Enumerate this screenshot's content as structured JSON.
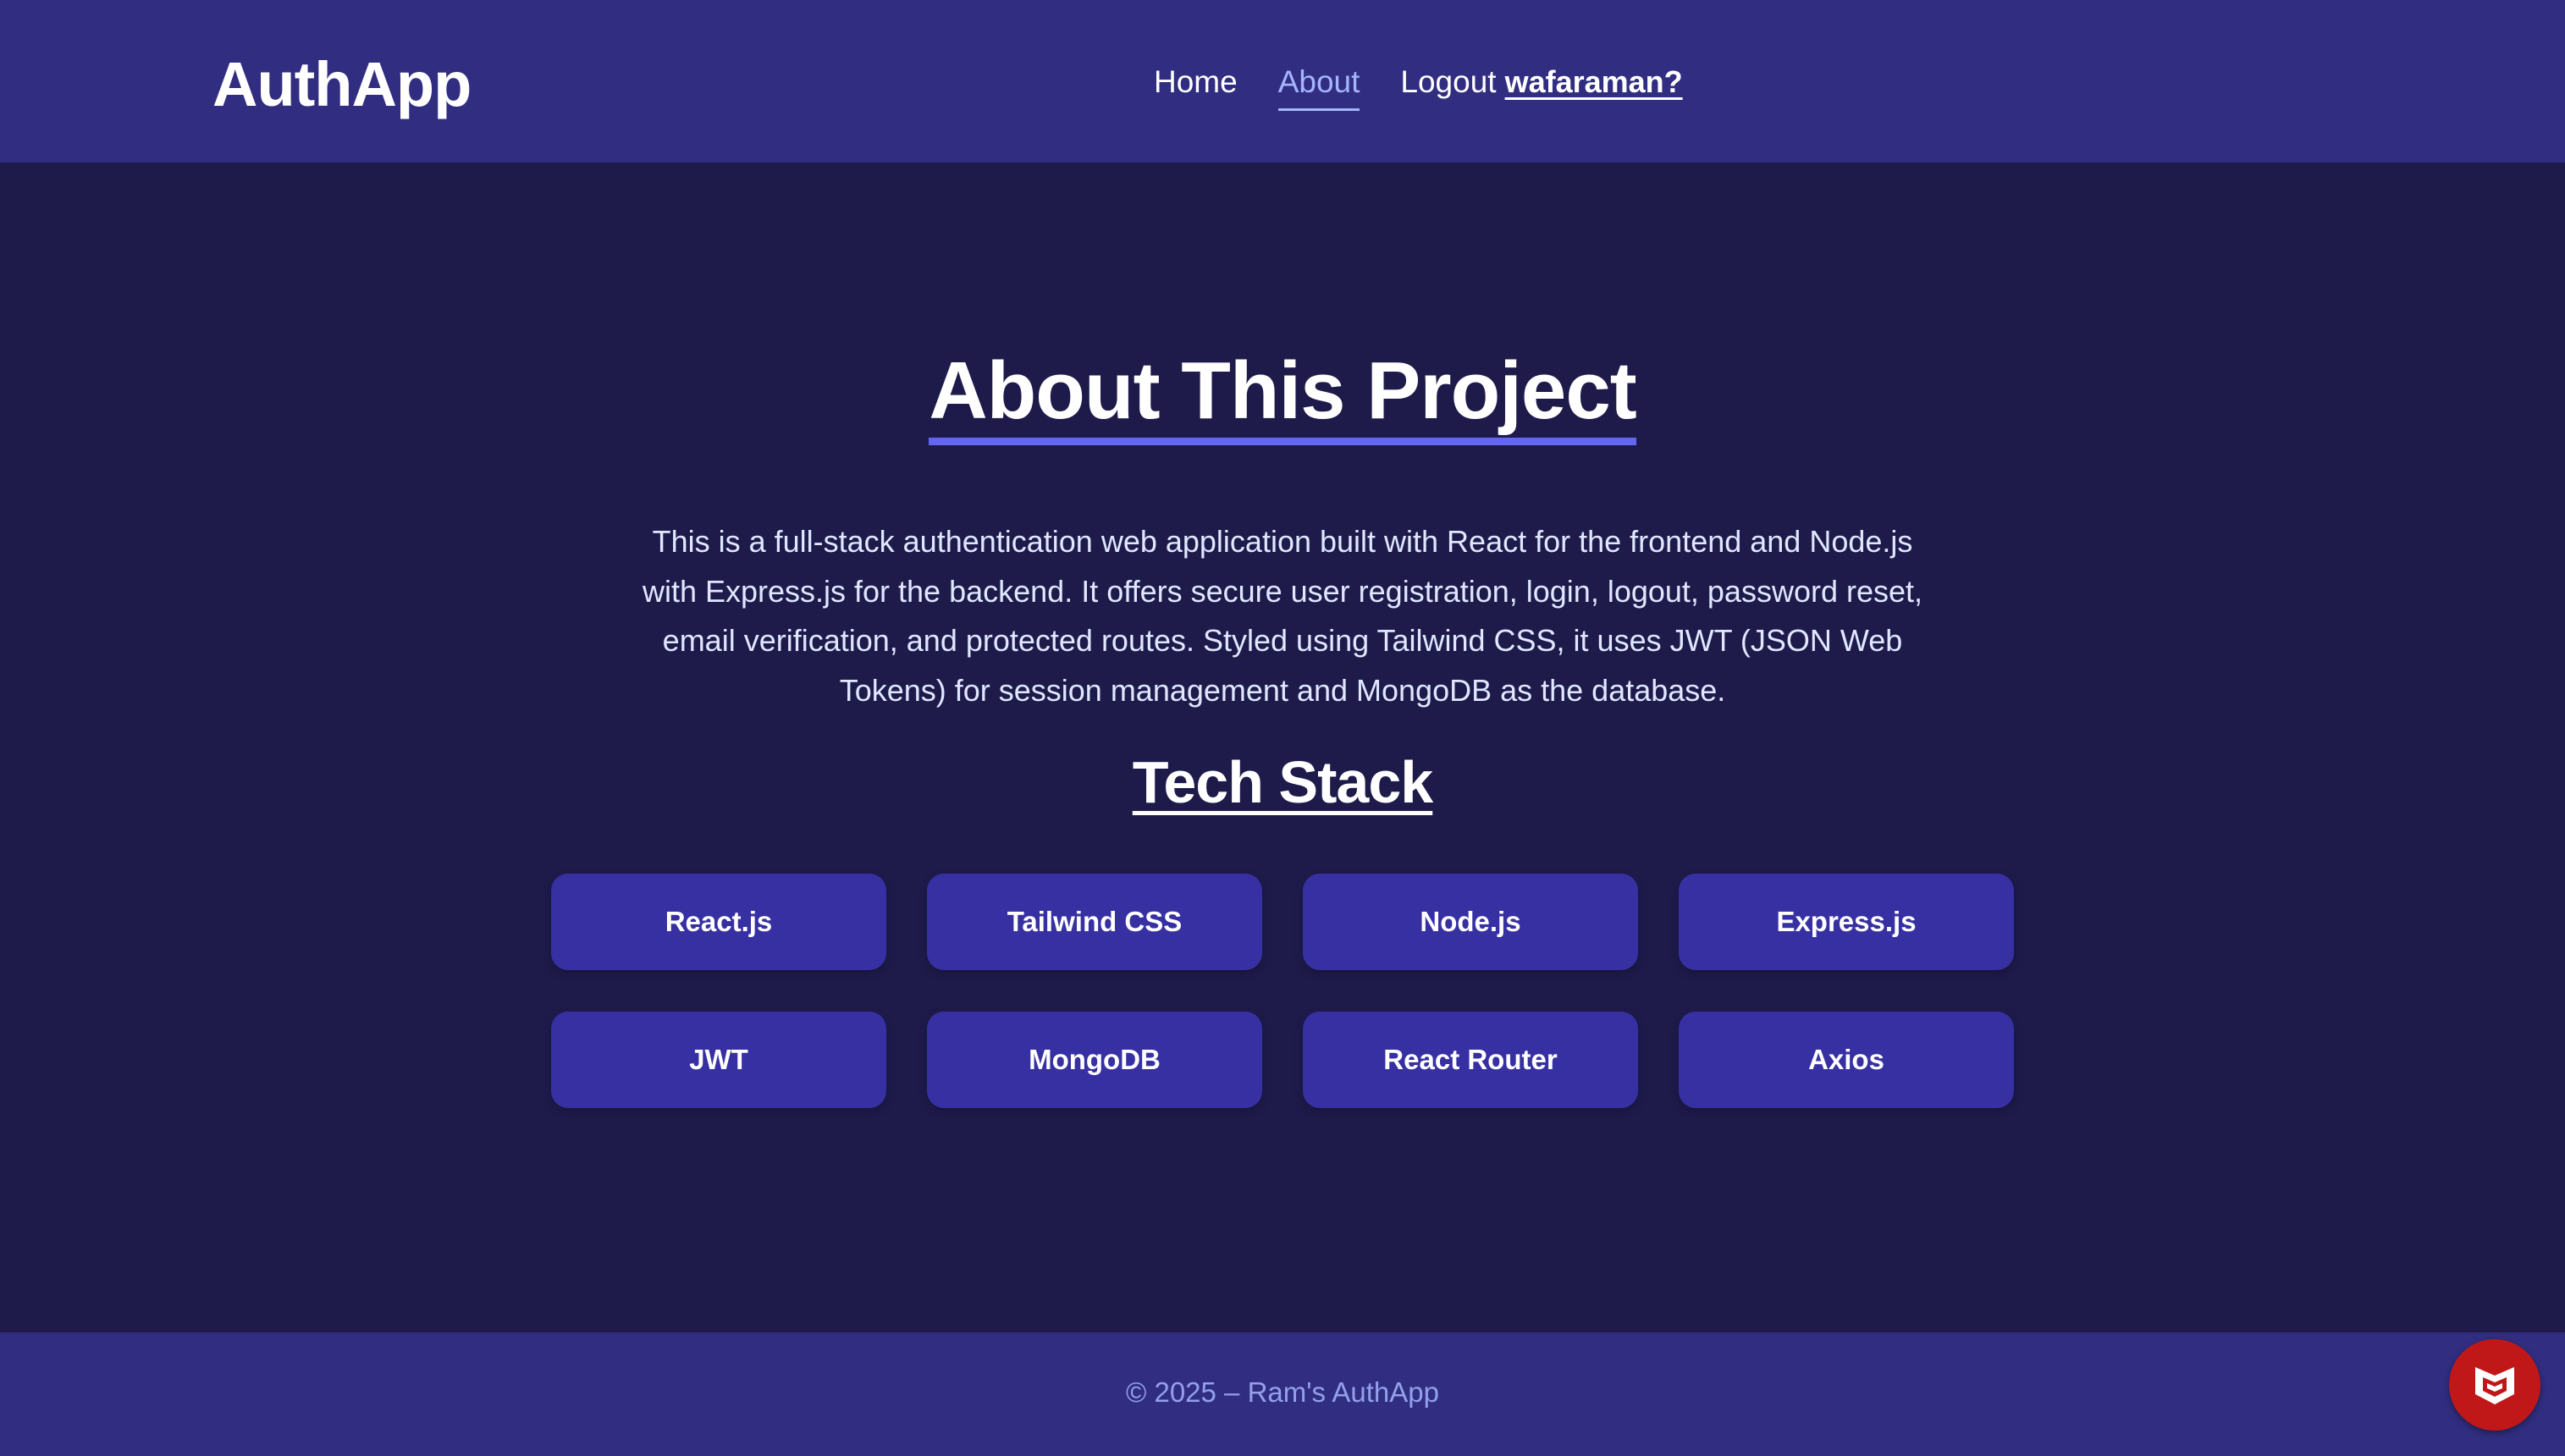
{
  "header": {
    "logo": "AuthApp",
    "nav": {
      "home": "Home",
      "about": "About",
      "logout": "Logout",
      "username": "wafaraman?"
    }
  },
  "main": {
    "title": "About This Project",
    "description": "This is a full-stack authentication web application built with React for the frontend and Node.js with Express.js for the backend. It offers secure user registration, login, logout, password reset, email verification, and protected routes. Styled using Tailwind CSS, it uses JWT (JSON Web Tokens) for session management and MongoDB as the database.",
    "tech_stack_title": "Tech Stack",
    "tech_stack": [
      "React.js",
      "Tailwind CSS",
      "Node.js",
      "Express.js",
      "JWT",
      "MongoDB",
      "React Router",
      "Axios"
    ]
  },
  "footer": {
    "copyright": "© 2025 – Ram's AuthApp"
  },
  "icons": {
    "badge": "shield-m-icon"
  },
  "colors": {
    "header_bg": "#312e81",
    "page_bg": "#1e1b4b",
    "accent": "#6366f1",
    "chip_bg": "#3730a3",
    "badge": "#c01818"
  }
}
